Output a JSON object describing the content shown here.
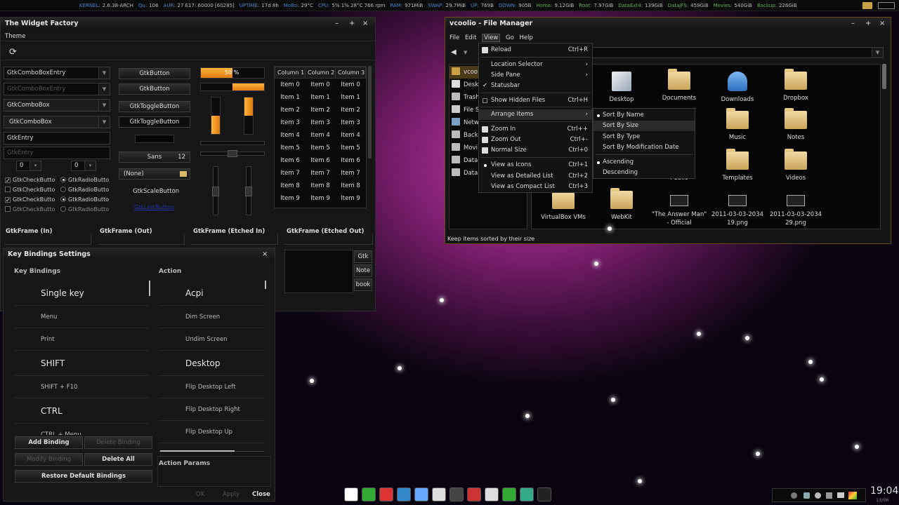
{
  "topbar": [
    {
      "label": "KERNEL:",
      "value": "2.6.38-ARCH"
    },
    {
      "label": "Qu:",
      "value": "106"
    },
    {
      "label": "AUR:",
      "value": "27 E17: 60000 [60285]"
    },
    {
      "label": "UPTIME:",
      "value": "17d 8h"
    },
    {
      "label": "MoBo:",
      "value": "29°C"
    },
    {
      "label": "CPU:",
      "value": "5%  1%  28°C  766 rpm"
    },
    {
      "label": "RAM:",
      "value": "971MiB"
    },
    {
      "label": "SWAP:",
      "value": "29.7MiB"
    },
    {
      "label": "UP:",
      "value": "769B"
    },
    {
      "label": "DOWN:",
      "value": "905B"
    },
    {
      "label": "Home:",
      "value": "9.12GiB"
    },
    {
      "label": "Root:",
      "value": "7.97GiB"
    },
    {
      "label": "DataExt4:",
      "value": "139GiB"
    },
    {
      "label": "DataJFS:",
      "value": "459GiB"
    },
    {
      "label": "Movies:",
      "value": "540GiB"
    },
    {
      "label": "Backup:",
      "value": "226GiB"
    }
  ],
  "widget_factory": {
    "title": "The Widget Factory",
    "menu_theme": "Theme",
    "combo_entry": "GtkComboBoxEntry",
    "combo_entry_dim": "GtkComboBoxEntry",
    "combo": "GtkComboBox",
    "combo2": "GtkComboBox",
    "entry": "GtkEntry",
    "entry_dim": "GtkEntry",
    "spin1": "0",
    "spin2": "0",
    "checks": [
      "GtkCheckButto",
      "GtkCheckButto",
      "GtkCheckButto",
      "GtkCheckButto"
    ],
    "radios": [
      "GtkRadioButto",
      "GtkRadioButto",
      "GtkRadioButto",
      "GtkRadioButto"
    ],
    "buttons": [
      "GtkButton",
      "GtkButton",
      "GtkToggleButton",
      "GtkToggleButton"
    ],
    "font_name": "Sans",
    "font_size": "12",
    "file_chooser": "(None)",
    "scale_button": "GtkScaleButton",
    "link": "GtkLinkButton",
    "progress_text": "50 %",
    "progress": 0.5,
    "columns": [
      "Column 1",
      "Column 2",
      "Column 3"
    ],
    "rows": [
      [
        "Item 0",
        "Item 0",
        "Item 0"
      ],
      [
        "Item 1",
        "Item 1",
        "Item 1"
      ],
      [
        "Item 2",
        "Item 2",
        "Item 2"
      ],
      [
        "Item 3",
        "Item 3",
        "Item 3"
      ],
      [
        "Item 4",
        "Item 4",
        "Item 4"
      ],
      [
        "Item 5",
        "Item 5",
        "Item 5"
      ],
      [
        "Item 6",
        "Item 6",
        "Item 6"
      ],
      [
        "Item 7",
        "Item 7",
        "Item 7"
      ],
      [
        "Item 8",
        "Item 8",
        "Item 8"
      ],
      [
        "Item 9",
        "Item 9",
        "Item 9"
      ]
    ],
    "frames": [
      "GtkFrame (In)",
      "GtkFrame (Out)",
      "GtkFrame (Etched In)",
      "GtkFrame (Etched Out)"
    ],
    "notebook_tabs": [
      "Gtk",
      "Note",
      "book"
    ]
  },
  "keybindings": {
    "title": "Key Bindings Settings",
    "col_keys": "Key Bindings",
    "col_action": "Action",
    "keys": [
      {
        "t": "Single key",
        "big": true
      },
      {
        "t": "Menu"
      },
      {
        "t": "Print"
      },
      {
        "t": "SHIFT",
        "big": true
      },
      {
        "t": "SHIFT + F10"
      },
      {
        "t": "CTRL",
        "big": true
      },
      {
        "t": "CTRL + Menu"
      }
    ],
    "actions": [
      {
        "t": "Acpi",
        "big": true
      },
      {
        "t": "Dim Screen"
      },
      {
        "t": "Undim Screen"
      },
      {
        "t": "Desktop",
        "big": true
      },
      {
        "t": "Flip Desktop Left"
      },
      {
        "t": "Flip Desktop Right"
      },
      {
        "t": "Flip Desktop Up"
      }
    ],
    "add": "Add Binding",
    "delete": "Delete Binding",
    "modify": "Modify Binding",
    "delete_all": "Delete All",
    "restore": "Restore Default Bindings",
    "params": "Action Params",
    "ok": "OK",
    "apply": "Apply",
    "close": "Close"
  },
  "file_manager": {
    "title": "vcoolio - File Manager",
    "menu": [
      "File",
      "Edit",
      "View",
      "Go",
      "Help"
    ],
    "location": "olio",
    "side": [
      "vcoo",
      "Desk",
      "Trash",
      "File S",
      "Netw",
      "Back",
      "Movi",
      "Data",
      "Data"
    ],
    "items": [
      {
        "name": "Desktop"
      },
      {
        "name": "Documents"
      },
      {
        "name": "Downloads"
      },
      {
        "name": "Dropbox"
      },
      {
        "name": "Music"
      },
      {
        "name": "Notes"
      },
      {
        "name": "Public"
      },
      {
        "name": "Templates"
      },
      {
        "name": "Videos"
      },
      {
        "name": "VirtualBox VMs"
      },
      {
        "name": "WebKit"
      },
      {
        "name": "\"The Answer Man\" - Official"
      },
      {
        "name": "2011-03-03-2034 19.png"
      },
      {
        "name": "2011-03-03-2034 29.png"
      }
    ],
    "status": "Keep items sorted by their size",
    "view_menu": [
      {
        "label": "Reload",
        "acc": "Ctrl+R"
      },
      {
        "label": "Location Selector",
        "acc": "›"
      },
      {
        "label": "Side Pane",
        "acc": "›"
      },
      {
        "label": "Statusbar",
        "acc": ""
      },
      {
        "label": "Show Hidden Files",
        "acc": "Ctrl+H"
      },
      {
        "label": "Arrange Items",
        "acc": "›"
      },
      {
        "label": "Zoom In",
        "acc": "Ctrl++"
      },
      {
        "label": "Zoom Out",
        "acc": "Ctrl+-"
      },
      {
        "label": "Normal Size",
        "acc": "Ctrl+0"
      },
      {
        "label": "View as Icons",
        "acc": "Ctrl+1"
      },
      {
        "label": "View as Detailed List",
        "acc": "Ctrl+2"
      },
      {
        "label": "View as Compact List",
        "acc": "Ctrl+3"
      }
    ],
    "arrange_menu": [
      "Sort By Name",
      "Sort By Size",
      "Sort By Type",
      "Sort By Modification Date",
      "Ascending",
      "Descending"
    ]
  },
  "clock": {
    "time": "19:04",
    "date": "13/06"
  }
}
